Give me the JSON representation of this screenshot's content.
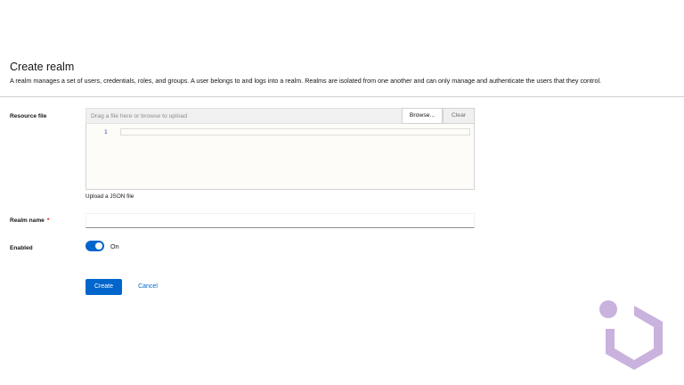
{
  "header": {
    "title": "Create realm",
    "description": "A realm manages a set of users, credentials, roles, and groups. A user belongs to and logs into a realm. Realms are isolated from one another and can only manage and authenticate the users that they control."
  },
  "form": {
    "resource_file": {
      "label": "Resource file",
      "placeholder": "Drag a file here or browse to upload",
      "browse_label": "Browse...",
      "clear_label": "Clear",
      "editor_line_number": "1",
      "helper_text": "Upload a JSON file"
    },
    "realm_name": {
      "label": "Realm name",
      "required_marker": "*",
      "value": ""
    },
    "enabled": {
      "label": "Enabled",
      "toggle_state": "On",
      "checked": true
    }
  },
  "actions": {
    "create_label": "Create",
    "cancel_label": "Cancel"
  },
  "colors": {
    "primary": "#0066cc",
    "required": "#c9190b",
    "watermark": "#c9b2dd"
  },
  "icons": {
    "watermark": "io-logo-icon"
  }
}
